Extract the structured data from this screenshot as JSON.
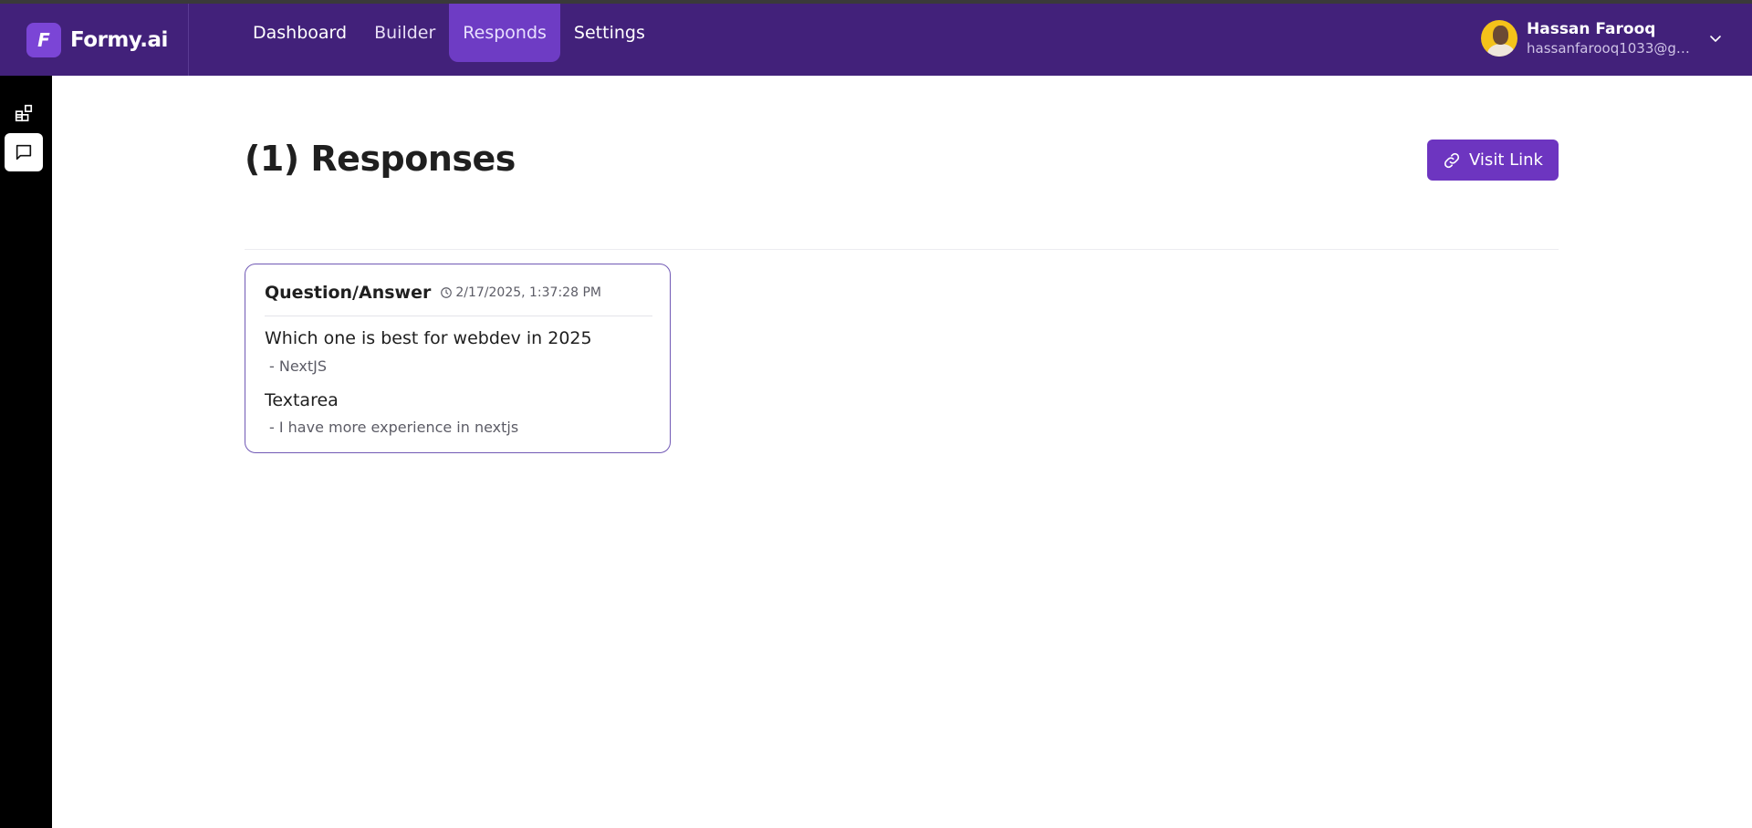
{
  "app": {
    "logo_letter": "F",
    "name": "Formy.ai"
  },
  "nav": {
    "items": [
      {
        "label": "Dashboard"
      },
      {
        "label": "Builder"
      },
      {
        "label": "Responds"
      },
      {
        "label": "Settings"
      }
    ],
    "active": "Responds"
  },
  "user": {
    "name": "Hassan Farooq",
    "email": "hassanfarooq1033@gmail.com"
  },
  "sidebar": {
    "items": [
      {
        "icon": "blocks-icon"
      },
      {
        "icon": "message-square-icon",
        "active": true
      }
    ]
  },
  "page": {
    "title": "(1) Responses",
    "visit_label": "Visit Link"
  },
  "response": {
    "heading": "Question/Answer",
    "timestamp": "2/17/2025, 1:37:28 PM",
    "items": [
      {
        "question": "Which one is best for webdev in 2025",
        "answer": "- NextJS"
      },
      {
        "question": "Textarea",
        "answer": "- I have more experience in nextjs"
      }
    ]
  },
  "colors": {
    "header": "#42217a",
    "accent": "#6d35c0",
    "active_nav": "#6e3cc4",
    "sidebar": "#000000"
  }
}
